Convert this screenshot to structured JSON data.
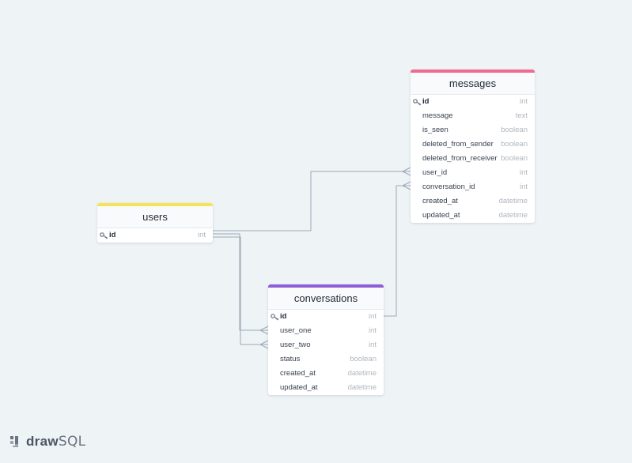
{
  "colors": {
    "users_accent": "#f5e35b",
    "messages_accent": "#ef6b8f",
    "conversations_accent": "#8e5ed6",
    "connector": "#9ca9b8"
  },
  "tables": {
    "users": {
      "title": "users",
      "columns": [
        {
          "name": "id",
          "type": "int",
          "pk": true
        }
      ]
    },
    "messages": {
      "title": "messages",
      "columns": [
        {
          "name": "id",
          "type": "int",
          "pk": true
        },
        {
          "name": "message",
          "type": "text"
        },
        {
          "name": "is_seen",
          "type": "boolean"
        },
        {
          "name": "deleted_from_sender",
          "type": "boolean"
        },
        {
          "name": "deleted_from_receiver",
          "type": "boolean"
        },
        {
          "name": "user_id",
          "type": "int"
        },
        {
          "name": "conversation_id",
          "type": "int"
        },
        {
          "name": "created_at",
          "type": "datetime"
        },
        {
          "name": "updated_at",
          "type": "datetime"
        }
      ]
    },
    "conversations": {
      "title": "conversations",
      "columns": [
        {
          "name": "id",
          "type": "int",
          "pk": true
        },
        {
          "name": "user_one",
          "type": "int"
        },
        {
          "name": "user_two",
          "type": "int"
        },
        {
          "name": "status",
          "type": "boolean"
        },
        {
          "name": "created_at",
          "type": "datetime"
        },
        {
          "name": "updated_at",
          "type": "datetime"
        }
      ]
    }
  },
  "relationships": [
    {
      "from": "users.id",
      "to": "messages.user_id"
    },
    {
      "from": "users.id",
      "to": "conversations.user_one"
    },
    {
      "from": "users.id",
      "to": "conversations.user_two"
    },
    {
      "from": "conversations.id",
      "to": "messages.conversation_id"
    }
  ],
  "branding": {
    "logo_bold": "draw",
    "logo_rest": "SQL",
    "icon": "drawsql-logo-icon"
  }
}
